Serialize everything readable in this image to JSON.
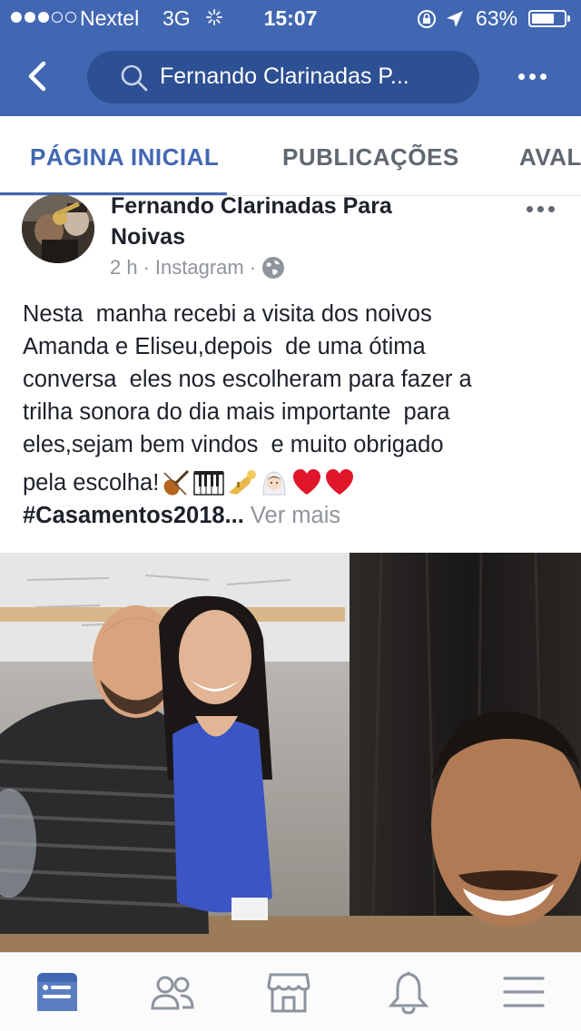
{
  "status_bar": {
    "carrier": "Nextel",
    "network": "3G",
    "time": "15:07",
    "battery_percent": "63%",
    "battery_level": 0.63,
    "signal_strength": 3,
    "signal_max": 5
  },
  "nav": {
    "back_icon": "back-chevron-icon",
    "search_text": "Fernando Clarinadas P...",
    "search_icon": "search-icon",
    "more_icon": "more-dots-icon"
  },
  "tabs": [
    {
      "label": "PÁGINA INICIAL",
      "active": true
    },
    {
      "label": "PUBLICAÇÕES",
      "active": false
    },
    {
      "label": "AVAL",
      "active": false
    }
  ],
  "post": {
    "author_line1": "Fernando Clarinadas Para",
    "author_line2": "Noivas",
    "time_ago": "2 h",
    "separator": "·",
    "source": "Instagram",
    "privacy_icon": "globe-icon",
    "text_lines": [
      "Nesta  manha recebi a visita dos noivos",
      "Amanda e Eliseu,depois  de uma ótima",
      "conversa  eles nos escolheram para fazer a",
      "trilha sonora do dia mais importante  para",
      "eles,sejam bem vindos  e muito obrigado"
    ],
    "last_line": "pela escolha!",
    "emojis": [
      "violin-emoji",
      "piano-keys-emoji",
      "trumpet-emoji",
      "bride-emoji",
      "red-heart-emoji",
      "red-heart-emoji"
    ],
    "hashtag": "#Casamentos2018...",
    "see_more": "Ver mais"
  },
  "bottom_nav": [
    {
      "icon": "news-feed-icon",
      "active": true
    },
    {
      "icon": "friends-icon",
      "active": false
    },
    {
      "icon": "marketplace-icon",
      "active": false
    },
    {
      "icon": "notifications-bell-icon",
      "active": false
    },
    {
      "icon": "menu-icon",
      "active": false
    }
  ],
  "colors": {
    "brand_blue": "#4267b2",
    "search_bg": "#2d4f93",
    "text_dark": "#1d2129",
    "text_muted": "#90949c",
    "tab_inactive": "#606770",
    "heart_red": "#e0162b"
  }
}
